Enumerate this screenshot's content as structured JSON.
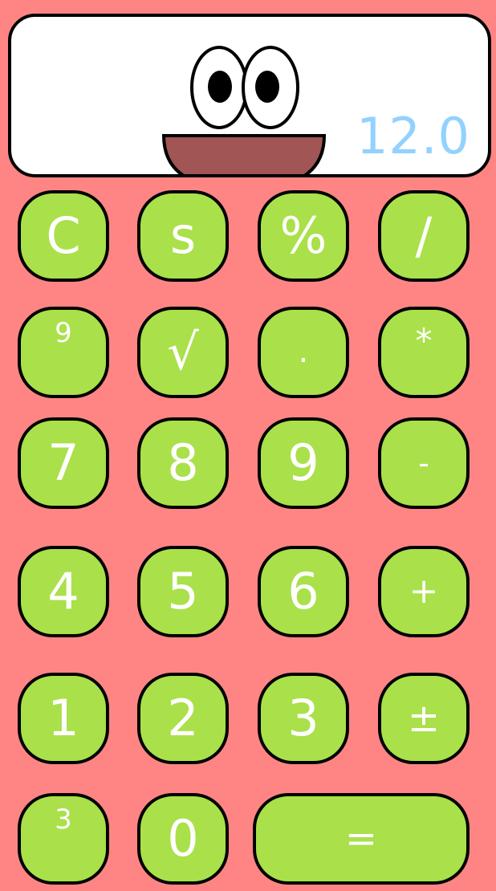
{
  "display": {
    "value": "12.0"
  },
  "colors": {
    "background": "#ff8585",
    "key_fill": "#aae04a",
    "key_text": "#ffffff",
    "display_fill": "#ffffff",
    "readout_text": "#93d1ff",
    "mouth": "#a15555"
  },
  "keys": {
    "clear": "C",
    "s": "s",
    "percent": "%",
    "divide": "/",
    "power9": "9",
    "sqrt": "√",
    "decimal": ".",
    "multiply": "*",
    "seven": "7",
    "eight": "8",
    "nine": "9",
    "minus": "-",
    "four": "4",
    "five": "5",
    "six": "6",
    "plus": "+",
    "one": "1",
    "two": "2",
    "three": "3",
    "plus_minus": "±",
    "power3": "3",
    "zero": "0",
    "equals": "="
  }
}
